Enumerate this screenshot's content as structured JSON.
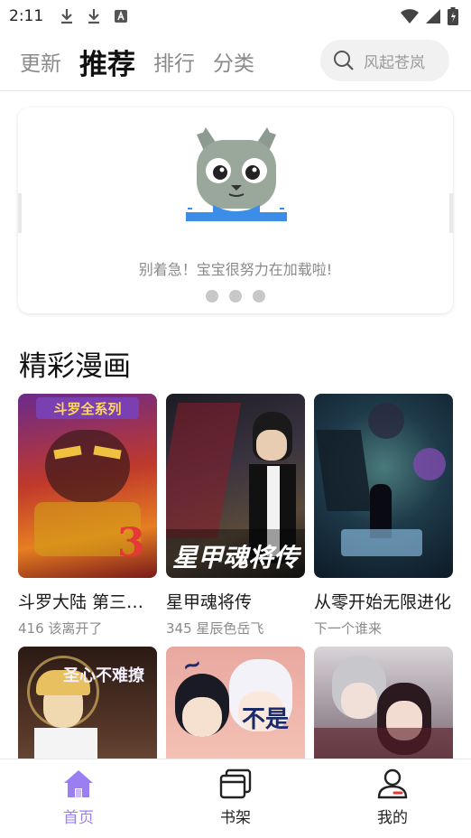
{
  "status": {
    "time": "2:11"
  },
  "tabs": [
    {
      "label": "更新"
    },
    {
      "label": "推荐"
    },
    {
      "label": "排行"
    },
    {
      "label": "分类"
    }
  ],
  "search": {
    "placeholder": "风起苍岚"
  },
  "banner": {
    "loading_text": "别着急！宝宝很努力在加载啦!",
    "dots": 3
  },
  "section": {
    "title": "精彩漫画"
  },
  "comics": [
    {
      "title": "斗罗大陆 第三部 龙王传说",
      "subtitle": "416 该离开了",
      "cover_text": "斗罗全系列"
    },
    {
      "title": "星甲魂将传",
      "subtitle": "345 星辰色岳飞",
      "cover_text": "星甲魂将传"
    },
    {
      "title": "从零开始无限进化",
      "subtitle": "下一个谁来",
      "cover_text": ""
    },
    {
      "title": "",
      "subtitle": "",
      "cover_text": "圣心不难撩"
    },
    {
      "title": "",
      "subtitle": "",
      "cover_text": "不是"
    },
    {
      "title": "",
      "subtitle": "",
      "cover_text": ""
    }
  ],
  "bottom_nav": [
    {
      "label": "首页",
      "icon": "home-icon"
    },
    {
      "label": "书架",
      "icon": "bookshelf-icon"
    },
    {
      "label": "我的",
      "icon": "profile-icon"
    }
  ],
  "colors": {
    "accent": "#9a7ff2",
    "tab_inactive": "#8a8a8a"
  }
}
